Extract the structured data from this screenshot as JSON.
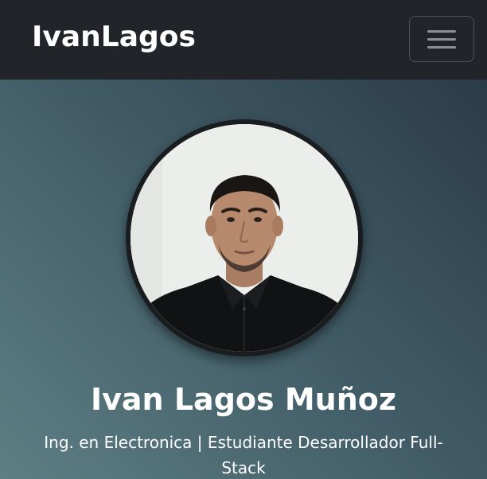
{
  "navbar": {
    "brand": "IvanLagos",
    "toggler_icon": "hamburger-menu-icon"
  },
  "hero": {
    "avatar_alt": "profile-photo",
    "name": "Ivan Lagos Muñoz",
    "subtitle": "Ing. en Electronica | Estudiante Desarrollador Full-Stack"
  },
  "colors": {
    "navbar_bg": "#212529",
    "hero_gradient_start": "#5f7e84",
    "hero_gradient_end": "#2b3c48",
    "text": "#ffffff"
  }
}
